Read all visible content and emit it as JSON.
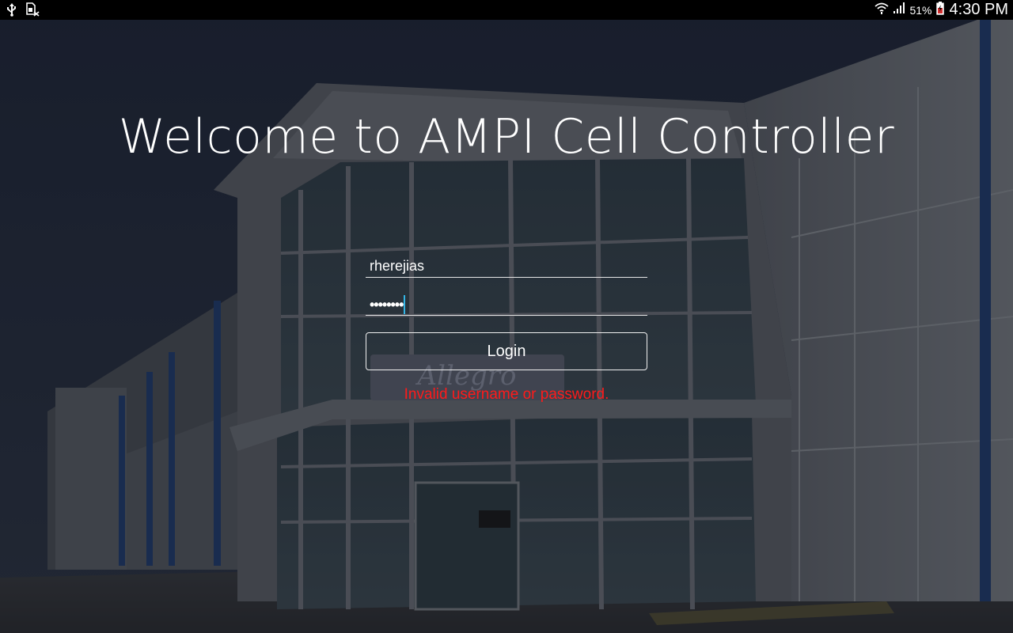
{
  "status_bar": {
    "left_icons": [
      "usb-icon",
      "sim-card-missing-icon"
    ],
    "right_icons": [
      "wifi-icon",
      "signal-icon",
      "battery-icon"
    ],
    "battery_percent": "51%",
    "time": "4:30 PM"
  },
  "login": {
    "title": "Welcome to AMPI Cell Controller",
    "username_value": "rherejias",
    "password_value": "••••••••",
    "login_button_label": "Login",
    "error_message": "Invalid username or password."
  },
  "colors": {
    "error": "#ff1a1a",
    "caret": "#33b5e5",
    "status_bar_bg": "#000000"
  }
}
